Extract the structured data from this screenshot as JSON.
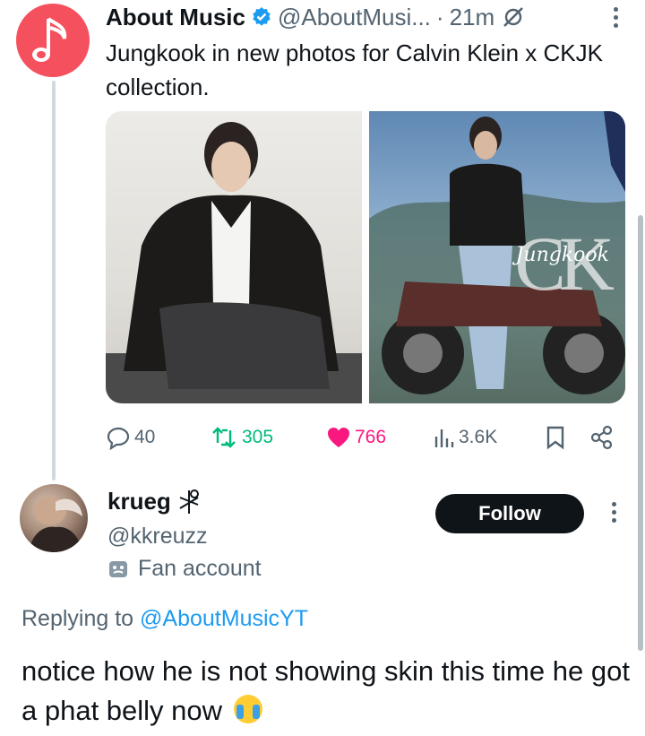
{
  "tweet": {
    "author_name": "About Music",
    "author_handle": "@AboutMusi...",
    "separator": "·",
    "time": "21m",
    "text": "Jungkook in new photos for Calvin Klein x CKJK collection.",
    "photos": [
      {
        "alt": "Jungkook leather jacket studio photo"
      },
      {
        "alt": "Jungkook on motorcycle",
        "overlay_mark": "CK",
        "overlay_signature": "Jungkook"
      }
    ],
    "stats": {
      "replies": "40",
      "retweets": "305",
      "likes": "766",
      "views": "3.6K"
    }
  },
  "reply": {
    "author_name": "krueg",
    "author_handle": "@kkreuzz",
    "label": "Fan account",
    "follow_label": "Follow",
    "replying_prefix": "Replying to",
    "replying_handle": "@AboutMusicYT",
    "text": "notice how he is not showing skin this time he got a phat belly now"
  },
  "colors": {
    "avatar_bg": "#f5505d",
    "verified": "#1d9bf0",
    "retweet": "#00ba7c",
    "like": "#f91880",
    "link": "#1d9bf0",
    "muted": "#536471"
  },
  "icons": [
    "music-note-icon",
    "verified-badge-icon",
    "grok-icon",
    "more-icon",
    "reply-icon",
    "retweet-icon",
    "heart-icon",
    "views-icon",
    "bookmark-icon",
    "share-icon",
    "mask-icon",
    "crying-emoji-icon"
  ]
}
